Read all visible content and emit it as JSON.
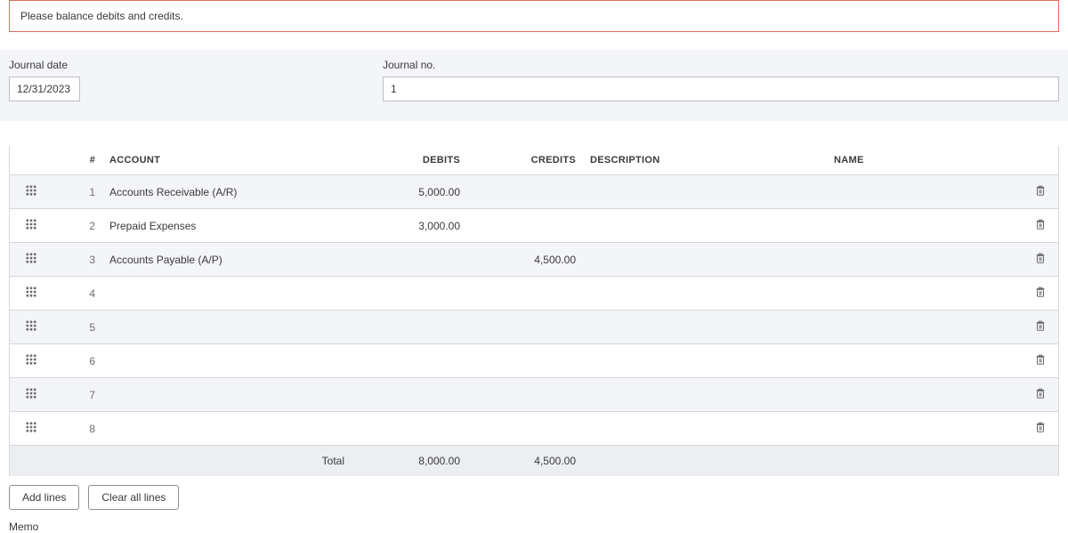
{
  "alert": "Please balance debits and credits.",
  "form": {
    "journal_date_label": "Journal date",
    "journal_date_value": "12/31/2023",
    "journal_no_label": "Journal no.",
    "journal_no_value": "1"
  },
  "headers": {
    "num": "#",
    "account": "ACCOUNT",
    "debits": "DEBITS",
    "credits": "CREDITS",
    "description": "DESCRIPTION",
    "name": "NAME"
  },
  "rows": [
    {
      "num": "1",
      "account": "Accounts Receivable (A/R)",
      "debits": "5,000.00",
      "credits": "",
      "description": "",
      "name": ""
    },
    {
      "num": "2",
      "account": "Prepaid Expenses",
      "debits": "3,000.00",
      "credits": "",
      "description": "",
      "name": ""
    },
    {
      "num": "3",
      "account": "Accounts Payable (A/P)",
      "debits": "",
      "credits": "4,500.00",
      "description": "",
      "name": ""
    },
    {
      "num": "4",
      "account": "",
      "debits": "",
      "credits": "",
      "description": "",
      "name": ""
    },
    {
      "num": "5",
      "account": "",
      "debits": "",
      "credits": "",
      "description": "",
      "name": ""
    },
    {
      "num": "6",
      "account": "",
      "debits": "",
      "credits": "",
      "description": "",
      "name": ""
    },
    {
      "num": "7",
      "account": "",
      "debits": "",
      "credits": "",
      "description": "",
      "name": ""
    },
    {
      "num": "8",
      "account": "",
      "debits": "",
      "credits": "",
      "description": "",
      "name": ""
    }
  ],
  "totals": {
    "label": "Total",
    "debits": "8,000.00",
    "credits": "4,500.00"
  },
  "actions": {
    "add_lines": "Add lines",
    "clear_all": "Clear all lines"
  },
  "memo_label": "Memo"
}
